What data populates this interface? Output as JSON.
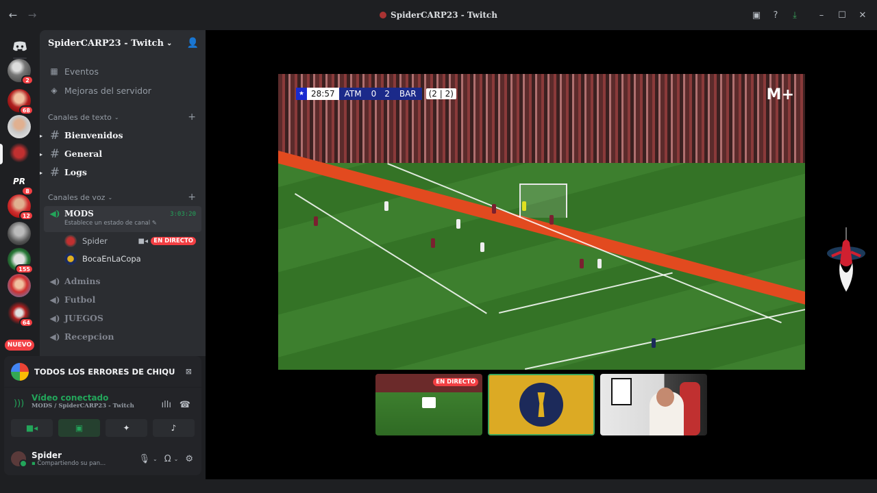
{
  "window": {
    "title": "SpiderCARP23 - Twitch"
  },
  "rail": {
    "badges": [
      "2",
      "68",
      "8",
      "12",
      "155",
      "64"
    ],
    "new_label": "NUEVO"
  },
  "sidebar": {
    "guild_name": "SpiderCARP23 - Twitch",
    "nav": [
      {
        "label": "Eventos",
        "icon": "calendar-icon"
      },
      {
        "label": "Mejoras del servidor",
        "icon": "boost-icon"
      }
    ],
    "text_category": "Canales de texto",
    "text_channels": [
      "Bienvenidos",
      "General",
      "Logs"
    ],
    "voice_category": "Canales de voz",
    "active_voice": {
      "name": "MODS",
      "time": "3:03:20",
      "status": "Establece un estado de canal"
    },
    "voice_users": [
      {
        "name": "Spider",
        "live": "EN DIRECTO"
      },
      {
        "name": "BocaEnLaCopa"
      }
    ],
    "voice_channels": [
      "Admins",
      "Futbol",
      "JUEGOS",
      "Recepcion"
    ]
  },
  "panel": {
    "activity_title": "TODOS LOS ERRORES DE CHIQUIT...",
    "voice_status": "Vídeo conectado",
    "voice_sub": "MODS / SpiderCARP23 - Twitch",
    "user_name": "Spider",
    "user_status": "Compartiendo su pan..."
  },
  "stream": {
    "clock": "28:57",
    "home": "ATM",
    "home_score": "0",
    "away_score": "2",
    "away": "BAR",
    "aggregate": "(2 | 2)",
    "broadcaster_logo": "M+"
  },
  "thumbnails": {
    "live_label": "EN DIRECTO"
  },
  "colors": {
    "accent_green": "#23a55a",
    "live_red": "#f23f43",
    "sidebar_bg": "#2b2d31",
    "rail_bg": "#1e1f22",
    "stage_bg": "#000000"
  }
}
